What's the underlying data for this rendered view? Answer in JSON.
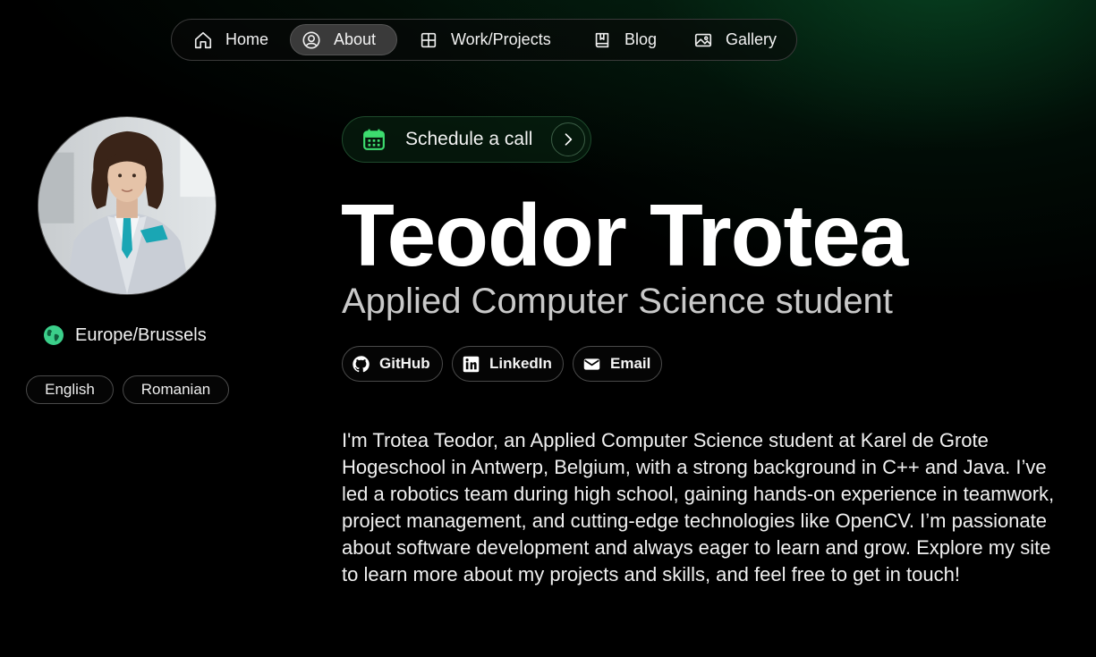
{
  "nav": {
    "items": [
      {
        "label": "Home",
        "icon": "home-icon",
        "active": false
      },
      {
        "label": "About",
        "icon": "user-circle-icon",
        "active": true
      },
      {
        "label": "Work/Projects",
        "icon": "grid-icon",
        "active": false
      },
      {
        "label": "Blog",
        "icon": "book-icon",
        "active": false
      },
      {
        "label": "Gallery",
        "icon": "image-icon",
        "active": false
      }
    ]
  },
  "profile": {
    "location": "Europe/Brussels",
    "languages": [
      "English",
      "Romanian"
    ]
  },
  "schedule": {
    "label": "Schedule a call"
  },
  "hero": {
    "name": "Teodor Trotea",
    "role": "Applied Computer Science student"
  },
  "social": [
    {
      "label": "GitHub",
      "icon": "github-icon"
    },
    {
      "label": "LinkedIn",
      "icon": "linkedin-icon"
    },
    {
      "label": "Email",
      "icon": "envelope-icon"
    }
  ],
  "bio": "I'm Trotea Teodor, an Applied Computer Science student at Karel de Grote Hogeschool in Antwerp, Belgium, with a strong background in C++ and Java. I’ve led a robotics team during high school, gaining hands-on experience in teamwork, project management, and cutting-edge technologies like OpenCV. I’m passionate about software development and always eager to learn and grow. Explore my site to learn more about my projects and skills, and feel free to get in touch!",
  "colors": {
    "accent": "#3ddc6f",
    "globe": "#3bcf8a",
    "background": "#000000"
  }
}
